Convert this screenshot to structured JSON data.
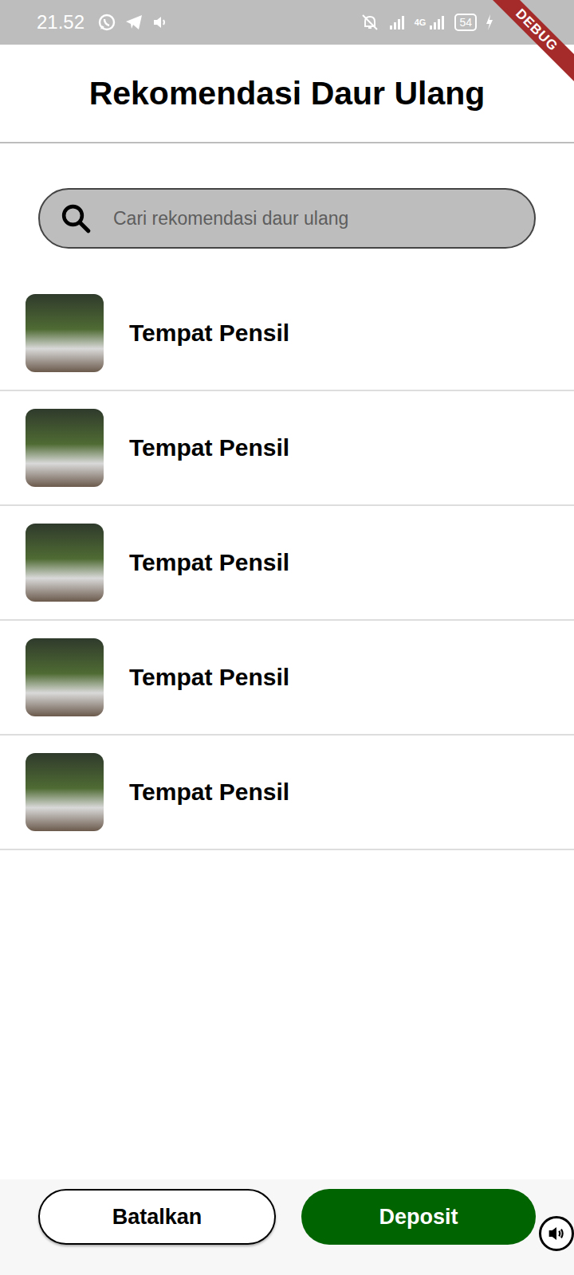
{
  "status_bar": {
    "time": "21.52",
    "network": "4G",
    "battery": "54"
  },
  "debug_banner": "DEBUG",
  "title": "Rekomendasi Daur Ulang",
  "search": {
    "placeholder": "Cari rekomendasi daur ulang"
  },
  "items": [
    {
      "title": "Tempat Pensil"
    },
    {
      "title": "Tempat Pensil"
    },
    {
      "title": "Tempat Pensil"
    },
    {
      "title": "Tempat Pensil"
    },
    {
      "title": "Tempat Pensil"
    }
  ],
  "buttons": [
    "Batalkan",
    "Deposit"
  ]
}
